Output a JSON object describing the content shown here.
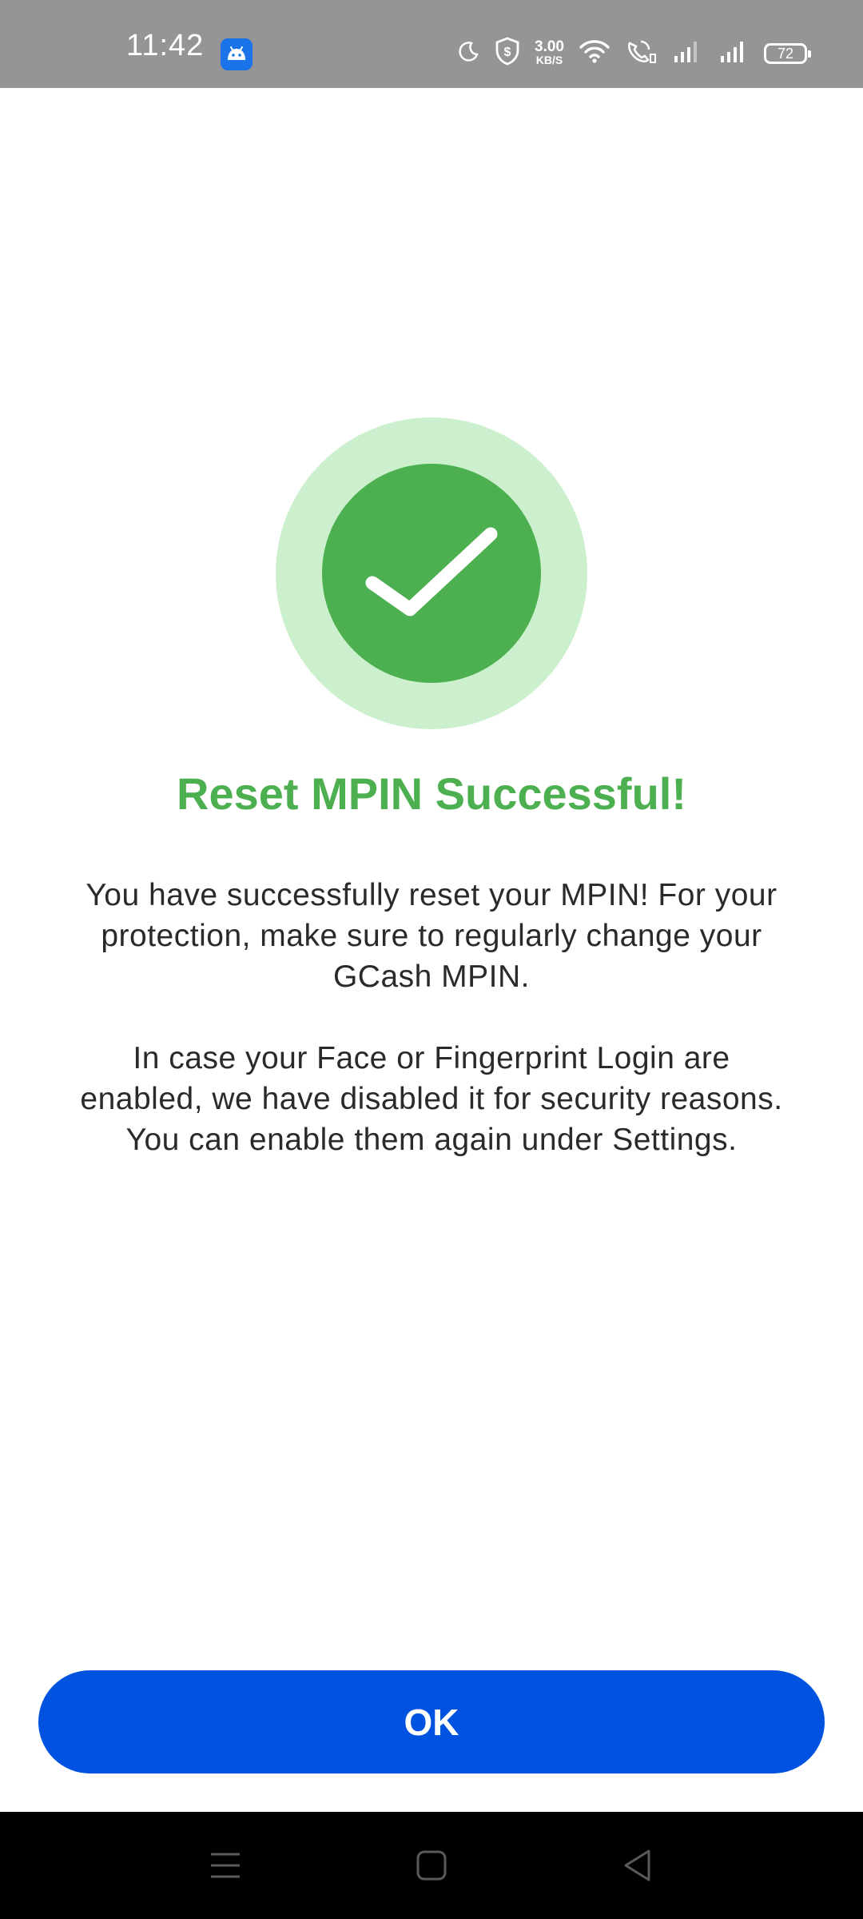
{
  "status_bar": {
    "time": "11:42",
    "app_icon": "android-icon",
    "icons": [
      "moon-icon",
      "shield-icon",
      "wifi-icon",
      "wifi-call-icon",
      "signal-icon",
      "signal-icon"
    ],
    "net_speed_value": "3.00",
    "net_speed_unit": "KB/S",
    "battery_level": "72"
  },
  "success": {
    "icon": "checkmark-icon",
    "title": "Reset MPIN Successful!",
    "message_1": "You have successfully reset your MPIN! For your protection, make sure to regularly change your GCash MPIN.",
    "message_2": "In case your Face or Fingerprint Login are enabled, we have disabled it for security reasons. You can enable them again under Settings."
  },
  "actions": {
    "ok_label": "OK"
  },
  "nav_bar": {
    "buttons": [
      "menu-icon",
      "home-icon",
      "back-icon"
    ]
  },
  "colors": {
    "accent_green": "#4caf50",
    "halo_green": "#ccf0cd",
    "primary_blue": "#0052e0",
    "status_bar_bg": "#959595",
    "nav_bar_bg": "#000000"
  }
}
